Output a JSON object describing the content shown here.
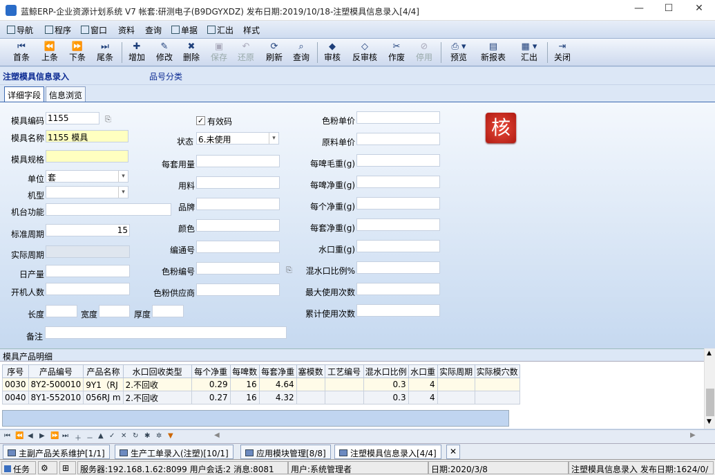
{
  "window": {
    "title": "蓝鲸ERP-企业资源计划系统 V7  帐套:研测电子(B9DGYXDZ)  发布日期:2019/10/18-注塑模具信息录入[4/4]"
  },
  "menu": [
    "导航",
    "程序",
    "窗口",
    "资料",
    "查询",
    "单据",
    "汇出",
    "样式"
  ],
  "toolbar": {
    "first": "首条",
    "prev": "上条",
    "next": "下条",
    "last": "尾条",
    "add": "增加",
    "edit": "修改",
    "delete": "删除",
    "save": "保存",
    "undo": "还原",
    "refresh": "刷新",
    "query": "查询",
    "audit": "审核",
    "unaudit": "反审核",
    "void": "作废",
    "disable": "停用",
    "preview": "预览",
    "newreport": "新报表",
    "export": "汇出",
    "close": "关闭"
  },
  "form": {
    "title": "注塑模具信息录入",
    "subtitle": "品号分类"
  },
  "tabs": [
    "详细字段",
    "信息浏览"
  ],
  "fields": {
    "mold_code_label": "模具编码",
    "mold_code": "1155",
    "mold_name_label": "模具名称",
    "mold_name": "1155 模具",
    "mold_spec_label": "模具规格",
    "mold_spec": "",
    "unit_label": "单位",
    "unit": "套",
    "machine_type_label": "机型",
    "machine_type": "",
    "machine_func_label": "机台功能",
    "machine_func": "",
    "std_cycle_label": "标准周期",
    "std_cycle": "15",
    "actual_cycle_label": "实际周期",
    "actual_cycle": "",
    "daily_output_label": "日产量",
    "daily_output": "",
    "operators_label": "开机人数",
    "operators": "",
    "length_label": "长度",
    "length": "",
    "width_label": "宽度",
    "width": "",
    "thickness_label": "厚度",
    "thickness": "",
    "remark_label": "备注",
    "remark": "",
    "valid_label": "有效码",
    "valid": true,
    "status_label": "状态",
    "status": "6.未使用",
    "per_set_usage_label": "每套用量",
    "per_set_usage": "",
    "material_label": "用料",
    "material": "",
    "brand_label": "品牌",
    "brand": "",
    "color_label": "颜色",
    "color": "",
    "serial_label": "编通号",
    "serial": "",
    "toner_code_label": "色粉编号",
    "toner_code": "",
    "toner_supplier_label": "色粉供应商",
    "toner_supplier": "",
    "toner_price_label": "色粉单价",
    "toner_price": "",
    "raw_price_label": "原料单价",
    "raw_price": "",
    "gross_per_shot_label": "每啤毛重(g)",
    "gross_per_shot": "",
    "net_per_shot_label": "每啤净重(g)",
    "net_per_shot": "",
    "net_each_label": "每个净重(g)",
    "net_each": "",
    "net_set_label": "每套净重(g)",
    "net_set": "",
    "sprue_label": "水口重(g)",
    "sprue": "",
    "sprue_ratio_label": "混水口比例%",
    "sprue_ratio": "",
    "max_use_label": "最大使用次数",
    "max_use": "",
    "total_use_label": "累计使用次数",
    "total_use": ""
  },
  "badge": "核",
  "grid": {
    "caption": "模具产品明细",
    "columns": [
      "序号",
      "产品编号",
      "产品名称",
      "水口回收类型",
      "每个净重",
      "每啤数",
      "每套净重",
      "塞模数",
      "工艺编号",
      "混水口比例",
      "水口重",
      "实际周期",
      "实际模穴数"
    ],
    "rows": [
      [
        "0030",
        "8Y2-500010",
        "9Y1（RJ",
        "2.不回收",
        "0.29",
        "16",
        "4.64",
        "",
        "",
        "0.3",
        "4",
        "",
        ""
      ],
      [
        "0040",
        "8Y1-552010",
        "056RJ m",
        "2.不回收",
        "0.27",
        "16",
        "4.32",
        "",
        "",
        "0.3",
        "4",
        "",
        ""
      ]
    ]
  },
  "mdi_tabs": [
    "主副产品关系维护[1/1]",
    "生产工单录入(注塑)[10/1]",
    "应用模块管理[8/8]",
    "注塑模具信息录入[4/4]"
  ],
  "mdi_close": "✕",
  "status": {
    "task": "任务",
    "server": "服务器:192.168.1.62:8099 用户会话:2 消息:8081",
    "user": "用户:系统管理者",
    "date": "日期:2020/3/8",
    "module": "注塑模具信息录入  发布日期:1624/0/"
  }
}
